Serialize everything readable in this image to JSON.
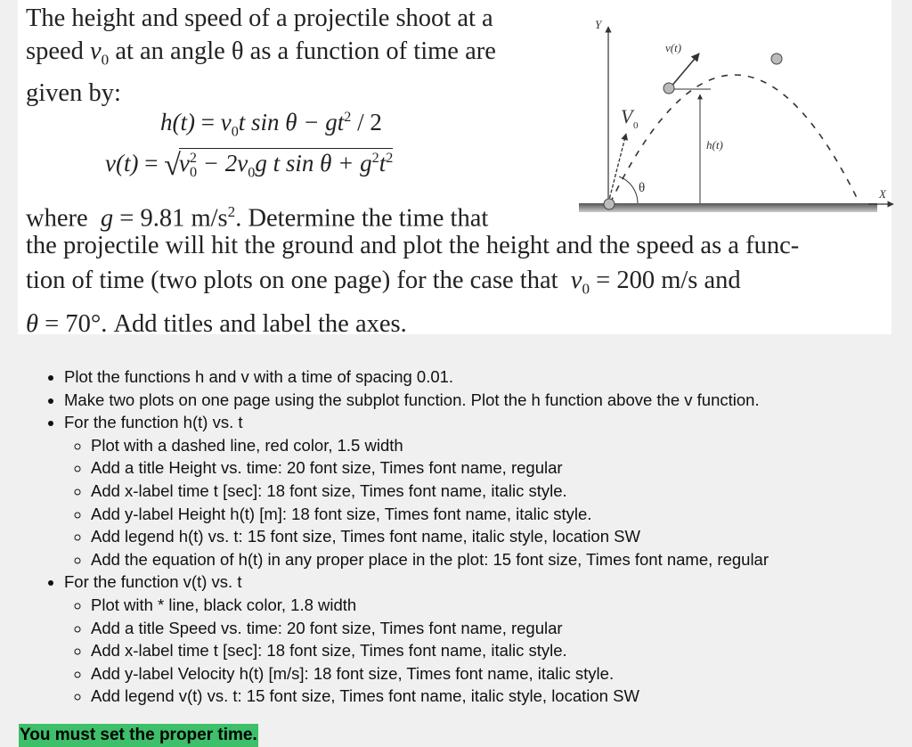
{
  "problem": {
    "intro": "The height and speed of a projectile shoot at a speed v₀ at an angle θ as a function of time are given by:",
    "intro_parts": {
      "p1": "The height and speed of a projectile shoot at a speed ",
      "v": "v",
      "v_sub": "0",
      "p2": " at an angle θ as a function of time are given by:"
    },
    "eq_h": {
      "lhs": "h(t)",
      "eq": " = ",
      "v": "v",
      "v_sub": "0",
      "rest": "t sin θ − gt",
      "sup": "2",
      "tail": " / 2"
    },
    "eq_v": {
      "lhs": "v(t)",
      "eq": " = ",
      "radical": "√",
      "a": "v",
      "a_sub": "0",
      "a_sup": "2",
      "b": " − 2v",
      "b_sub": "0",
      "c": "g t sin θ + g",
      "c_sup": "2",
      "d": "t",
      "d_sup": "2"
    },
    "where": {
      "w1": "where  ",
      "g": "g",
      "w2": " = 9.81 m/s",
      "sup": "2",
      "w3": ". Determine the time that"
    },
    "para": {
      "l1": "the projectile will hit the ground and plot the height and the speed as a func-",
      "l2a": "tion of time (two plots on one page) for the case that  ",
      "v": "v",
      "v_sub": "0",
      "l2b": " = 200 m/s and",
      "theta": "θ",
      "l3": " = 70°. Add titles and label the axes."
    },
    "diagram": {
      "y_axis": "Y",
      "x_axis": "X",
      "v0_label": "V",
      "v0_sub": "0",
      "vt_label": "v(t)",
      "ht_label": "h(t)",
      "theta": "θ"
    }
  },
  "tasks": [
    {
      "text": "Plot the functions h and v with a time of spacing 0.01."
    },
    {
      "text": "Make two plots on one page using the subplot function. Plot the h function above the v function."
    },
    {
      "text": "For the function h(t) vs. t",
      "sub": [
        "Plot with a dashed line, red color, 1.5 width",
        "Add a title Height vs. time: 20 font size, Times font name, regular",
        "Add x-label time t [sec]: 18 font size, Times font name, italic style.",
        "Add y-label Height h(t) [m]: 18 font size, Times font name, italic style.",
        "Add legend h(t) vs. t: 15 font size, Times font name, italic style, location SW",
        "Add the equation of h(t) in any proper place in the plot: 15 font size, Times font name, regular"
      ]
    },
    {
      "text": "For the function v(t) vs. t",
      "sub": [
        "Plot with * line, black color, 1.8 width",
        "Add a title Speed vs. time: 20 font size, Times font name, regular",
        "Add x-label time t [sec]: 18 font size, Times font name, italic style.",
        "Add y-label Velocity h(t) [m/s]: 18 font size, Times font name, italic style.",
        "Add legend v(t) vs. t: 15 font size, Times font name, italic style, location SW"
      ]
    }
  ],
  "note": {
    "text": "You must set the proper time.",
    "highlight_color": "#3ebf6a"
  }
}
